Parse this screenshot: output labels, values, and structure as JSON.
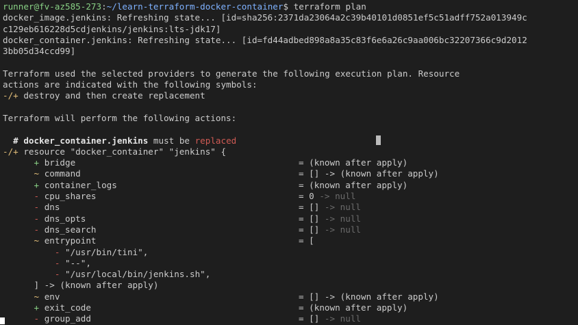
{
  "prompt": {
    "user": "runner@fv-az585-273",
    "sep": ":",
    "path": "~/learn-terraform-docker-container",
    "symbol": "$",
    "command": " terraform plan"
  },
  "refresh": {
    "line1": "docker_image.jenkins: Refreshing state... [id=sha256:2371da23064a2c39b40101d0851ef5c51adff752a013949c",
    "line2": "c129eb616228d5cdjenkins/jenkins:lts-jdk17]",
    "line3": "docker_container.jenkins: Refreshing state... [id=fd44adbed898a8a35c83f6e6a26c9aa006bc32207366c9d2012",
    "line4": "3bb05d34ccd99]"
  },
  "plan_intro": {
    "line1": "Terraform used the selected providers to generate the following execution plan. Resource",
    "line2": "actions are indicated with the following symbols:",
    "sym": "-/+",
    "sym_text": " destroy and then create replacement"
  },
  "perform": "Terraform will perform the following actions:",
  "resource_comment": {
    "hash": "  # ",
    "name": "docker_container.jenkins",
    "mid": " must be ",
    "state": "replaced"
  },
  "resource_header": {
    "sym": "-/+",
    "text": " resource \"docker_container\" \"jenkins\" {"
  },
  "attrs": [
    {
      "sym": "+",
      "name": "bridge",
      "value": "= (known after apply)"
    },
    {
      "sym": "~",
      "name": "command",
      "value": "= [] -> (known after apply)"
    },
    {
      "sym": "+",
      "name": "container_logs",
      "value": "= (known after apply)"
    },
    {
      "sym": "-",
      "name": "cpu_shares",
      "value": "= 0",
      "arrow": " -> null"
    },
    {
      "sym": "-",
      "name": "dns",
      "value": "= []",
      "arrow": " -> null"
    },
    {
      "sym": "-",
      "name": "dns_opts",
      "value": "= []",
      "arrow": " -> null"
    },
    {
      "sym": "-",
      "name": "dns_search",
      "value": "= []",
      "arrow": " -> null"
    },
    {
      "sym": "~",
      "name": "entrypoint",
      "value": "= ["
    }
  ],
  "entrypoint_items": [
    {
      "sym": "-",
      "value": "\"/usr/bin/tini\","
    },
    {
      "sym": "-",
      "value": "\"--\","
    },
    {
      "sym": "-",
      "value": "\"/usr/local/bin/jenkins.sh\","
    }
  ],
  "entrypoint_close": "] -> (known after apply)",
  "attrs2": [
    {
      "sym": "~",
      "name": "env",
      "value": "= [] -> (known after apply)"
    },
    {
      "sym": "+",
      "name": "exit_code",
      "value": "= (known after apply)"
    },
    {
      "sym": "-",
      "name": "group_add",
      "value": "= []",
      "arrow": " -> null"
    }
  ],
  "colors": {
    "background": "#1e1e1e",
    "prompt_user": "#89d185",
    "prompt_path": "#7fb2ff",
    "add": "#89d185",
    "change": "#e5c07b",
    "remove": "#d05b54",
    "null": "#6b6b6b"
  }
}
